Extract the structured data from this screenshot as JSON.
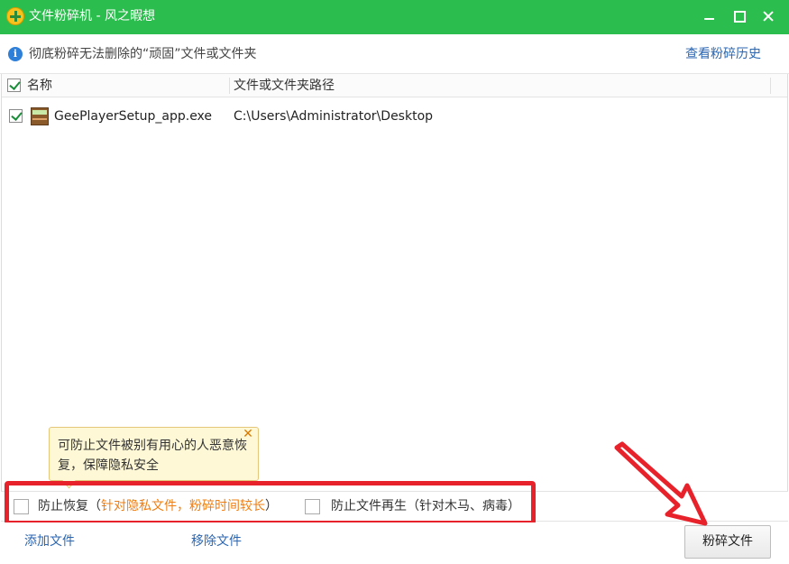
{
  "window": {
    "title": "文件粉碎机 - 风之暇想"
  },
  "infobar": {
    "message": "彻底粉碎无法删除的“顽固”文件或文件夹",
    "history_link": "查看粉碎历史"
  },
  "list": {
    "columns": [
      "名称",
      "文件或文件夹路径"
    ],
    "header_checked": true,
    "rows": [
      {
        "checked": true,
        "name": "GeePlayerSetup_app.exe",
        "path": "C:\\Users\\Administrator\\Desktop",
        "icon": "installer-file-icon"
      }
    ]
  },
  "tooltip": {
    "text": "可防止文件被别有用心的人恶意恢复，保障隐私安全",
    "close_glyph": "✕"
  },
  "options": {
    "prevent_recovery": {
      "label": "防止恢复",
      "open": "（",
      "hint": "针对隐私文件，粉碎时间较长",
      "close": "）",
      "checked": false
    },
    "prevent_regeneration": {
      "label": "防止文件再生",
      "hint": "（针对木马、病毒）",
      "checked": false
    }
  },
  "actions": {
    "add_file": "添加文件",
    "remove_file": "移除文件",
    "shred": "粉碎文件"
  },
  "colors": {
    "titlebar": "#2bbd4d",
    "link": "#2c66b0",
    "hint": "#f07d10",
    "highlight": "#e8222b"
  }
}
